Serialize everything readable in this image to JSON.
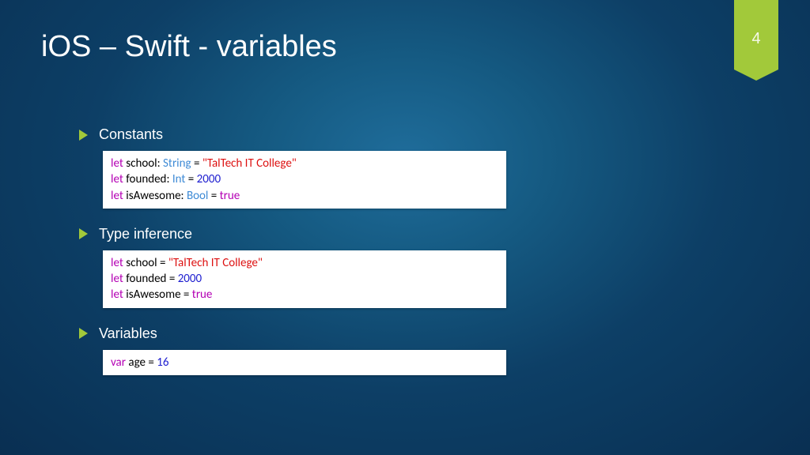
{
  "title": "iOS – Swift - variables",
  "pageNumber": "4",
  "tokens": {
    "let": "let",
    "var": "var"
  },
  "sections": [
    {
      "heading": "Constants",
      "lines": [
        {
          "name": "school",
          "type": "String",
          "value": "\"TalTech IT College\""
        },
        {
          "name": "founded",
          "type": "Int",
          "value": "2000"
        },
        {
          "name": "isAwesome",
          "type": "Bool",
          "value": "true"
        }
      ]
    },
    {
      "heading": "Type inference",
      "lines": [
        {
          "name": "school",
          "value": "\"TalTech IT College\""
        },
        {
          "name": "founded",
          "value": "2000"
        },
        {
          "name": "isAwesome",
          "value": "true"
        }
      ]
    },
    {
      "heading": "Variables",
      "lines": [
        {
          "name": "age",
          "value": "16"
        }
      ]
    }
  ]
}
